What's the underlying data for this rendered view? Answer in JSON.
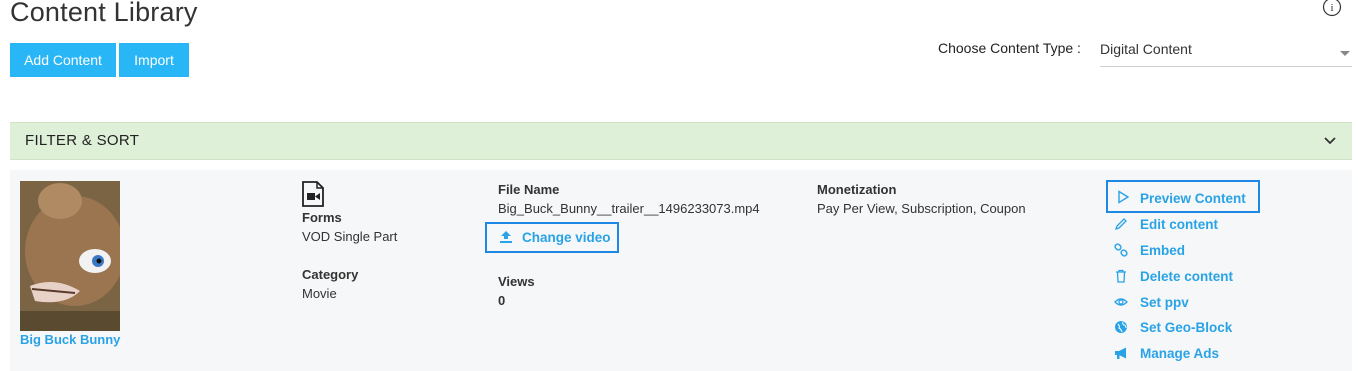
{
  "header": {
    "title": "Content Library",
    "add_button": "Add Content",
    "import_button": "Import",
    "content_type_label": "Choose Content Type :",
    "content_type_value": "Digital Content"
  },
  "filter": {
    "label": "FILTER & SORT"
  },
  "item": {
    "title": "Big Buck Bunny",
    "forms_label": "Forms",
    "forms_value": "VOD Single Part",
    "category_label": "Category",
    "category_value": "Movie",
    "file_name_label": "File Name",
    "file_name_value": "Big_Buck_Bunny__trailer__1496233073.mp4",
    "change_video": "Change video",
    "views_label": "Views",
    "views_value": "0",
    "monetization_label": "Monetization",
    "monetization_value": "Pay Per View, Subscription, Coupon"
  },
  "actions": [
    {
      "label": "Preview Content",
      "icon": "play-icon"
    },
    {
      "label": "Edit content",
      "icon": "pencil-icon"
    },
    {
      "label": "Embed",
      "icon": "link-icon"
    },
    {
      "label": "Delete content",
      "icon": "trash-icon"
    },
    {
      "label": "Set ppv",
      "icon": "eye-icon"
    },
    {
      "label": "Set Geo-Block",
      "icon": "globe-icon"
    },
    {
      "label": "Manage Ads",
      "icon": "megaphone-icon"
    }
  ],
  "colors": {
    "accent": "#29b6f6",
    "link": "#29a3e6",
    "filter_bg": "#dff0d8",
    "highlight_border": "#1e88e5"
  }
}
